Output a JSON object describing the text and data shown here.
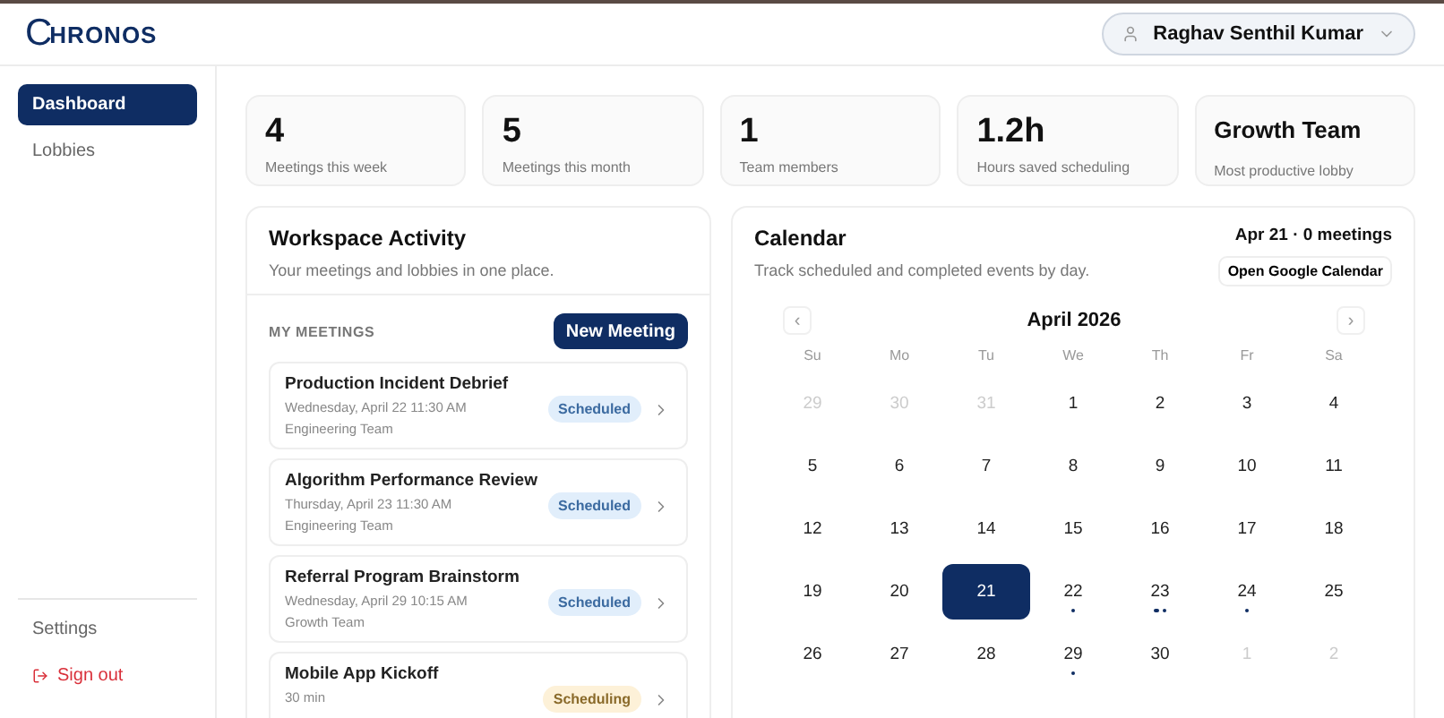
{
  "brand": {
    "logo_letter": "C",
    "name": "HRONOS"
  },
  "user": {
    "name": "Raghav Senthil Kumar"
  },
  "sidebar": {
    "items": [
      {
        "label": "Dashboard",
        "selected": true
      },
      {
        "label": "Lobbies",
        "selected": false
      }
    ],
    "footer": [
      {
        "label": "Settings",
        "kind": "plain"
      },
      {
        "label": "Sign out",
        "kind": "danger"
      }
    ]
  },
  "stats": [
    {
      "value": "4",
      "label": "Meetings this week"
    },
    {
      "value": "5",
      "label": "Meetings this month"
    },
    {
      "value": "1",
      "label": "Team members"
    },
    {
      "value": "1.2h",
      "label": "Hours saved scheduling"
    },
    {
      "value": "Growth Team",
      "label": "Most productive lobby",
      "kind": "text"
    }
  ],
  "activity": {
    "title": "Workspace Activity",
    "subtitle": "Your meetings and lobbies in one place.",
    "section": "MY MEETINGS",
    "new_button": "New Meeting",
    "meetings": [
      {
        "title": "Production Incident Debrief",
        "when": "Wednesday, April 22 11:30 AM",
        "team": "Engineering Team",
        "status": "Scheduled",
        "kind": "scheduled"
      },
      {
        "title": "Algorithm Performance Review",
        "when": "Thursday, April 23 11:30 AM",
        "team": "Engineering Team",
        "status": "Scheduled",
        "kind": "scheduled"
      },
      {
        "title": "Referral Program Brainstorm",
        "when": "Wednesday, April 29 10:15 AM",
        "team": "Growth Team",
        "status": "Scheduled",
        "kind": "scheduled"
      },
      {
        "title": "Mobile App Kickoff",
        "when": "30 min",
        "status": "Scheduling",
        "kind": "scheduling"
      }
    ]
  },
  "calendar": {
    "title": "Calendar",
    "subtitle": "Track scheduled and completed events by day.",
    "summary": "Apr 21 · 0 meetings",
    "google_button": "Open Google Calendar",
    "prev": "‹",
    "next": "›",
    "month": "April 2026",
    "weekdays": [
      "Su",
      "Mo",
      "Tu",
      "We",
      "Th",
      "Fr",
      "Sa"
    ],
    "days": [
      {
        "label": "29",
        "muted": true,
        "selected": false
      },
      {
        "label": "30",
        "muted": true,
        "selected": false
      },
      {
        "label": "31",
        "muted": true,
        "selected": false
      },
      {
        "label": "1",
        "muted": false,
        "selected": false
      },
      {
        "label": "2",
        "muted": false,
        "selected": false
      },
      {
        "label": "3",
        "muted": false,
        "selected": false
      },
      {
        "label": "4",
        "muted": false,
        "selected": false
      },
      {
        "label": "5",
        "muted": false,
        "selected": false
      },
      {
        "label": "6",
        "muted": false,
        "selected": false
      },
      {
        "label": "7",
        "muted": false,
        "selected": false
      },
      {
        "label": "8",
        "muted": false,
        "selected": false
      },
      {
        "label": "9",
        "muted": false,
        "selected": false
      },
      {
        "label": "10",
        "muted": false,
        "selected": false
      },
      {
        "label": "11",
        "muted": false,
        "selected": false
      },
      {
        "label": "12",
        "muted": false,
        "selected": false
      },
      {
        "label": "13",
        "muted": false,
        "selected": false
      },
      {
        "label": "14",
        "muted": false,
        "selected": false
      },
      {
        "label": "15",
        "muted": false,
        "selected": false
      },
      {
        "label": "16",
        "muted": false,
        "selected": false
      },
      {
        "label": "17",
        "muted": false,
        "selected": false
      },
      {
        "label": "18",
        "muted": false,
        "selected": false
      },
      {
        "label": "19",
        "muted": false,
        "selected": false
      },
      {
        "label": "20",
        "muted": false,
        "selected": false
      },
      {
        "label": "21",
        "muted": false,
        "selected": true
      },
      {
        "label": "22",
        "muted": false,
        "selected": false,
        "events": [
          {
            "kind": "meeting"
          }
        ]
      },
      {
        "label": "23",
        "muted": false,
        "selected": false,
        "events": [
          {
            "kind": "meeting"
          },
          {
            "kind": "meeting"
          }
        ]
      },
      {
        "label": "24",
        "muted": false,
        "selected": false,
        "events": [
          {
            "kind": "meeting"
          }
        ]
      },
      {
        "label": "25",
        "muted": false,
        "selected": false
      },
      {
        "label": "26",
        "muted": false,
        "selected": false
      },
      {
        "label": "27",
        "muted": false,
        "selected": false
      },
      {
        "label": "28",
        "muted": false,
        "selected": false
      },
      {
        "label": "29",
        "muted": false,
        "selected": false,
        "events": [
          {
            "kind": "meeting"
          }
        ]
      },
      {
        "label": "30",
        "muted": false,
        "selected": false
      },
      {
        "label": "1",
        "muted": true,
        "selected": false
      },
      {
        "label": "2",
        "muted": true,
        "selected": false
      }
    ]
  }
}
